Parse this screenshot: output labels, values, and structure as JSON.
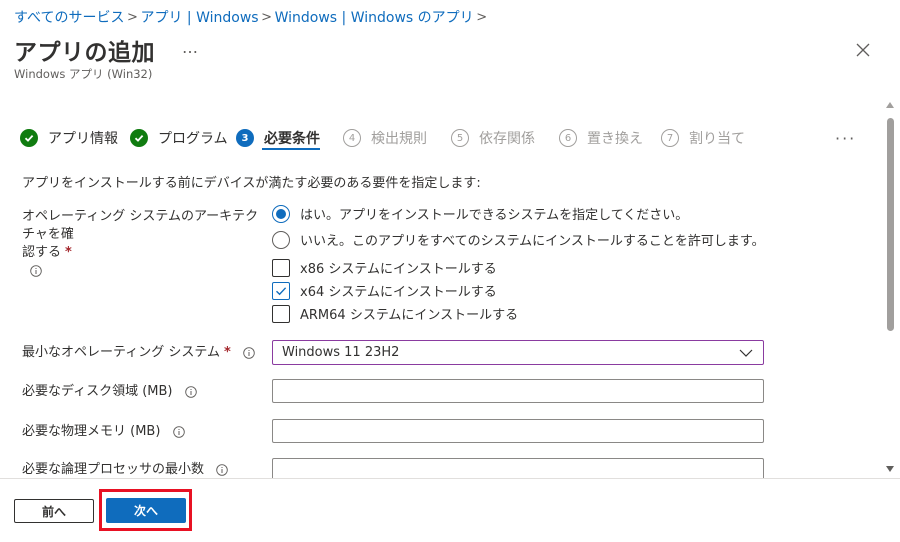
{
  "breadcrumb": {
    "items": [
      "すべてのサービス",
      "アプリ | Windows",
      "Windows | Windows のアプリ"
    ],
    "separator": ">"
  },
  "header": {
    "title": "アプリの追加",
    "more": "…",
    "subtitle": "Windows アプリ (Win32)"
  },
  "steps": [
    {
      "number": "✓",
      "label": "アプリ情報",
      "state": "done"
    },
    {
      "number": "✓",
      "label": "プログラム",
      "state": "done"
    },
    {
      "number": "3",
      "label": "必要条件",
      "state": "active"
    },
    {
      "number": "4",
      "label": "検出規則",
      "state": "pending"
    },
    {
      "number": "5",
      "label": "依存関係",
      "state": "pending"
    },
    {
      "number": "6",
      "label": "置き換え",
      "state": "pending"
    },
    {
      "number": "7",
      "label": "割り当て",
      "state": "pending"
    }
  ],
  "steps_more": "···",
  "intro": "アプリをインストールする前にデバイスが満たす必要のある要件を指定します:",
  "architecture": {
    "label_line1": "オペレーティング システムのアーキテクチャを確",
    "label_line2": "認する",
    "required_mark": "*",
    "options": [
      {
        "label": "はい。アプリをインストールできるシステムを指定してください。",
        "selected": true
      },
      {
        "label": "いいえ。このアプリをすべてのシステムにインストールすることを許可します。",
        "selected": false
      }
    ],
    "checkboxes": [
      {
        "label": "x86 システムにインストールする",
        "checked": false
      },
      {
        "label": "x64 システムにインストールする",
        "checked": true
      },
      {
        "label": "ARM64 システムにインストールする",
        "checked": false
      }
    ]
  },
  "min_os": {
    "label": "最小なオペレーティング システム",
    "required_mark": "*",
    "value": "Windows 11 23H2"
  },
  "disk_space": {
    "label": "必要なディスク領域 (MB)",
    "value": ""
  },
  "physical_memory": {
    "label": "必要な物理メモリ (MB)",
    "value": ""
  },
  "min_processors": {
    "label": "必要な論理プロセッサの最小数",
    "value": ""
  },
  "footer": {
    "prev_label": "前へ",
    "next_label": "次へ"
  },
  "colors": {
    "accent": "#0f6cbd",
    "done": "#107c10",
    "highlight": "#e81123",
    "select_border": "#8a3ba0"
  }
}
